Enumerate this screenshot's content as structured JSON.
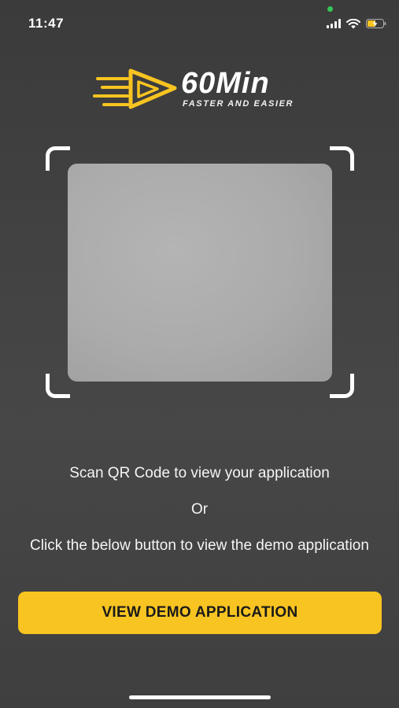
{
  "status_bar": {
    "time": "11:47",
    "icons": [
      "signal-icon",
      "wifi-icon",
      "battery-charging-icon"
    ]
  },
  "logo": {
    "title": "60Min",
    "tagline": "FASTER AND EASIER",
    "icon": "fast-play-icon",
    "accent_color": "#f8c421"
  },
  "scanner": {
    "window_color": "#ababab",
    "frame_color": "#ffffff"
  },
  "instructions": {
    "scan": "Scan QR Code to view your application",
    "or": "Or",
    "demo": "Click the below button to view the demo application"
  },
  "button": {
    "label": "VIEW DEMO APPLICATION",
    "color": "#f8c421"
  }
}
